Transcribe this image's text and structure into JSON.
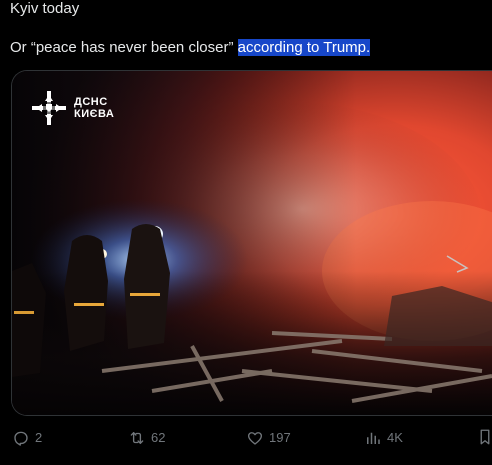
{
  "post": {
    "line1": "Kyiv today",
    "line2_prefix": "Or “peace has never been closer” ",
    "line2_selected": "according to Trump."
  },
  "media": {
    "watermark_line1": "ДСНС",
    "watermark_line2": "КИЄВА",
    "alt": "Firefighters with flashlights amid smoke and debris at night"
  },
  "actions": {
    "replies": "2",
    "reposts": "62",
    "likes": "197",
    "views": "4K"
  },
  "icons": {
    "reply": "reply-icon",
    "repost": "repost-icon",
    "like": "heart-icon",
    "views": "views-icon",
    "bookmark": "bookmark-icon"
  },
  "colors": {
    "background": "#000000",
    "text": "#e7e9ea",
    "muted": "#71767b",
    "selection": "#1747c9"
  }
}
